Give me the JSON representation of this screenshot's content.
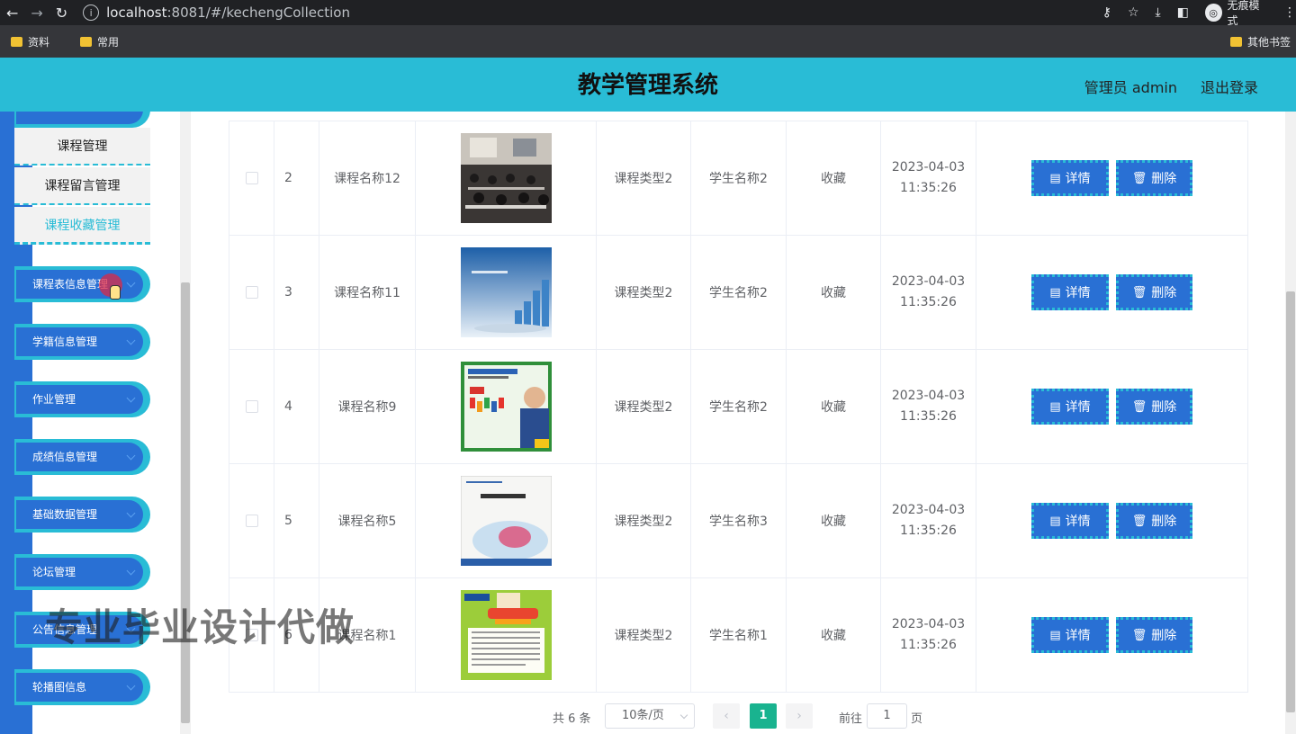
{
  "browser": {
    "url_host": "localhost",
    "url_rest": ":8081/#/kechengCollection",
    "incognito_label": "无痕模式",
    "bookmarks": [
      "资料",
      "常用"
    ],
    "other_bookmarks": "其他书签"
  },
  "header": {
    "title": "教学管理系统",
    "user": "管理员 admin",
    "logout": "退出登录"
  },
  "sidebar": {
    "sub_items": [
      "课程管理",
      "课程留言管理",
      "课程收藏管理"
    ],
    "menus": [
      "课程表信息管理",
      "学籍信息管理",
      "作业管理",
      "成绩信息管理",
      "基础数据管理",
      "论坛管理",
      "公告信息管理",
      "轮播图信息"
    ]
  },
  "table": {
    "rows": [
      {
        "index": "2",
        "name": "课程名称12",
        "type": "课程类型2",
        "student": "学生名称2",
        "collect": "收藏",
        "date": "2023-04-03",
        "time": "11:35:26"
      },
      {
        "index": "3",
        "name": "课程名称11",
        "type": "课程类型2",
        "student": "学生名称2",
        "collect": "收藏",
        "date": "2023-04-03",
        "time": "11:35:26"
      },
      {
        "index": "4",
        "name": "课程名称9",
        "type": "课程类型2",
        "student": "学生名称2",
        "collect": "收藏",
        "date": "2023-04-03",
        "time": "11:35:26"
      },
      {
        "index": "5",
        "name": "课程名称5",
        "type": "课程类型2",
        "student": "学生名称3",
        "collect": "收藏",
        "date": "2023-04-03",
        "time": "11:35:26"
      },
      {
        "index": "6",
        "name": "课程名称1",
        "type": "课程类型2",
        "student": "学生名称1",
        "collect": "收藏",
        "date": "2023-04-03",
        "time": "11:35:26"
      }
    ],
    "detail_label": "详情",
    "delete_label": "删除"
  },
  "pager": {
    "total": "共 6 条",
    "page_size": "10条/页",
    "current": "1",
    "goto": "前往",
    "goto_value": "1",
    "unit": "页"
  },
  "watermark": "专业毕业设计代做",
  "colors": {
    "header": "#29bcd6",
    "primary": "#2970d4",
    "pager_active": "#19b38f"
  }
}
